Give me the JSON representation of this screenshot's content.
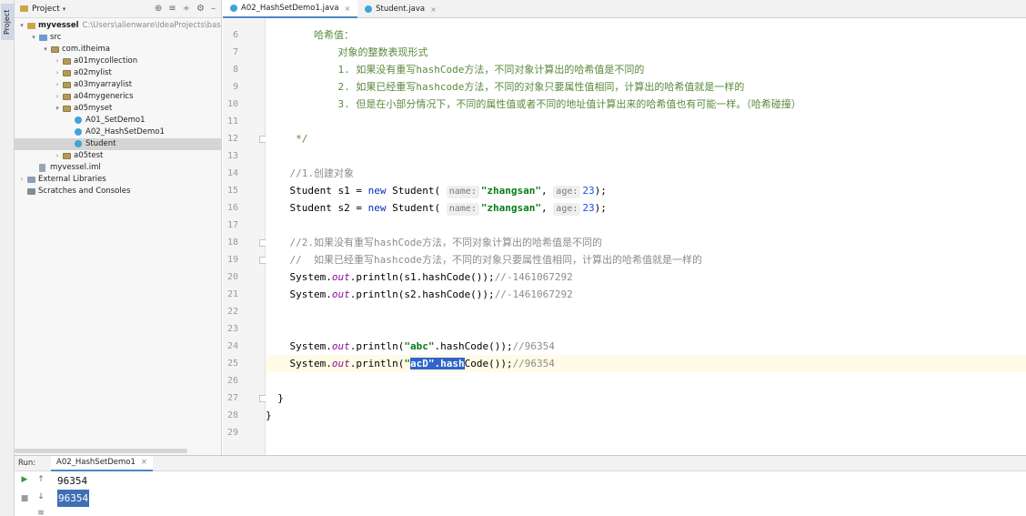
{
  "sidebar_strip": {
    "project_tab": "Project"
  },
  "project_panel": {
    "title": "Project",
    "tree": [
      {
        "label": "myvessel",
        "path": "C:\\Users\\alienware\\IdeaProjects\\basic-cod",
        "bold": true,
        "depth": 0,
        "arrow": "▾",
        "icon": "folder"
      },
      {
        "label": "src",
        "depth": 1,
        "arrow": "▾",
        "icon": "src"
      },
      {
        "label": "com.itheima",
        "depth": 2,
        "arrow": "▾",
        "icon": "pkg"
      },
      {
        "label": "a01mycollection",
        "depth": 3,
        "arrow": "›",
        "icon": "pkg"
      },
      {
        "label": "a02mylist",
        "depth": 3,
        "arrow": "›",
        "icon": "pkg"
      },
      {
        "label": "a03myarraylist",
        "depth": 3,
        "arrow": "›",
        "icon": "pkg"
      },
      {
        "label": "a04mygenerics",
        "depth": 3,
        "arrow": "›",
        "icon": "pkg"
      },
      {
        "label": "a05myset",
        "depth": 3,
        "arrow": "▾",
        "icon": "pkg"
      },
      {
        "label": "A01_SetDemo1",
        "depth": 4,
        "arrow": "",
        "icon": "cls"
      },
      {
        "label": "A02_HashSetDemo1",
        "depth": 4,
        "arrow": "",
        "icon": "cls"
      },
      {
        "label": "Student",
        "depth": 4,
        "arrow": "",
        "icon": "cls",
        "selected": true
      },
      {
        "label": "a05test",
        "depth": 3,
        "arrow": "›",
        "icon": "pkg"
      },
      {
        "label": "myvessel.iml",
        "depth": 1,
        "arrow": "",
        "icon": "file"
      },
      {
        "label": "External Libraries",
        "depth": 0,
        "arrow": "›",
        "icon": "lib"
      },
      {
        "label": "Scratches and Consoles",
        "depth": 0,
        "arrow": "",
        "icon": "scratch"
      }
    ]
  },
  "editor_tabs": [
    {
      "label": "A02_HashSetDemo1.java",
      "active": true
    },
    {
      "label": "Student.java",
      "active": false
    }
  ],
  "code_lines": [
    {
      "n": "6",
      "html": "        <span class=\"doc cjk\">哈希值：</span>"
    },
    {
      "n": "7",
      "html": "            <span class=\"doc cjk\">对象的整数表现形式</span>"
    },
    {
      "n": "8",
      "html": "            <span class=\"doc\">1. <span class=\"cjk\">如果没有重写</span>hashCode<span class=\"cjk\">方法，不同对象计算出的哈希值是不同的</span></span>"
    },
    {
      "n": "9",
      "html": "            <span class=\"doc\">2. <span class=\"cjk\">如果已经重写</span>hashcode<span class=\"cjk\">方法，不同的对象只要属性值相同，计算出的哈希值就是一样的</span></span>"
    },
    {
      "n": "10",
      "html": "            <span class=\"doc\">3. <span class=\"cjk\">但是在小部分情况下，不同的属性值或者不同的地址值计算出来的哈希值也有可能一样。（哈希碰撞）</span></span>"
    },
    {
      "n": "11",
      "html": ""
    },
    {
      "n": "12",
      "html": "     <span class=\"doc\">*/</span>"
    },
    {
      "n": "13",
      "html": ""
    },
    {
      "n": "14",
      "html": "    <span class=\"cm\">//1.<span class=\"cjk\">创建对象</span></span>"
    },
    {
      "n": "15",
      "html": "    Student s1 = <span class=\"kw\">new</span> Student( <span class=\"hint\">name:</span><span class=\"str\">\"zhangsan\"</span>, <span class=\"hint\">age:</span><span class=\"num\">23</span>);"
    },
    {
      "n": "16",
      "html": "    Student s2 = <span class=\"kw\">new</span> Student( <span class=\"hint\">name:</span><span class=\"str\">\"zhangsan\"</span>, <span class=\"hint\">age:</span><span class=\"num\">23</span>);"
    },
    {
      "n": "17",
      "html": ""
    },
    {
      "n": "18",
      "html": "    <span class=\"cm\">//2.<span class=\"cjk\">如果没有重写</span>hashCode<span class=\"cjk\">方法，不同对象计算出的哈希值是不同的</span></span>"
    },
    {
      "n": "19",
      "html": "    <span class=\"cm\">//  <span class=\"cjk\">如果已经重写</span>hashcode<span class=\"cjk\">方法，不同的对象只要属性值相同，计算出的哈希值就是一样的</span></span>"
    },
    {
      "n": "20",
      "html": "    System.<span class=\"fld\">out</span>.println(s1.hashCode());<span class=\"cm\">//-1461067292</span>"
    },
    {
      "n": "21",
      "html": "    System.<span class=\"fld\">out</span>.println(s2.hashCode());<span class=\"cm\">//-1461067292</span>"
    },
    {
      "n": "22",
      "html": ""
    },
    {
      "n": "23",
      "html": ""
    },
    {
      "n": "24",
      "html": "    System.<span class=\"fld\">out</span>.println(<span class=\"str\">\"abc\"</span>.hashCode());<span class=\"cm\">//96354</span>"
    },
    {
      "n": "25",
      "html": "    System.<span class=\"fld\">out</span>.println(<span class=\"str\">\"<span class=\"sel\">acD\".hash</span></span>Code());<span class=\"cm\">//96354</span>",
      "caret": true
    },
    {
      "n": "26",
      "html": ""
    },
    {
      "n": "27",
      "html": "  }"
    },
    {
      "n": "28",
      "html": "}"
    },
    {
      "n": "29",
      "html": ""
    }
  ],
  "run_panel": {
    "label": "Run:",
    "tab": "A02_HashSetDemo1",
    "output": [
      "96354",
      "96354"
    ]
  }
}
